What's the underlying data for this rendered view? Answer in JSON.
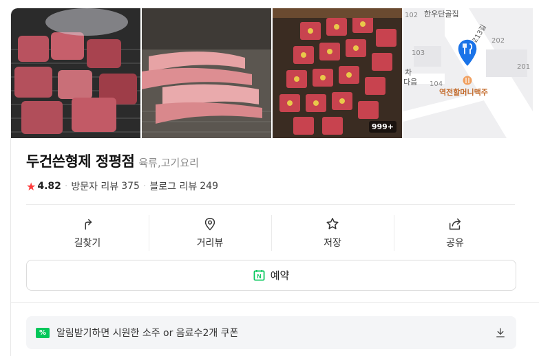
{
  "place": {
    "name": "두건쓴형제 정평점",
    "category": "육류,고기요리",
    "rating": "4.82",
    "visitor_review_label": "방문자 리뷰",
    "visitor_review_count": "375",
    "blog_review_label": "블로그 리뷰",
    "blog_review_count": "249"
  },
  "photos": {
    "count_badge": "999+"
  },
  "map": {
    "street_top": "한우단골집",
    "street_side": "로13길",
    "labels": [
      "102",
      "103",
      "104",
      "202",
      "201"
    ],
    "poi_name": "역전할머니맥주",
    "partial_text": "차",
    "partial_text2": "다음"
  },
  "actions": [
    {
      "label": "길찾기",
      "icon": "directions-icon"
    },
    {
      "label": "거리뷰",
      "icon": "street-view-icon"
    },
    {
      "label": "저장",
      "icon": "star-icon"
    },
    {
      "label": "공유",
      "icon": "share-icon"
    }
  ],
  "reservation": {
    "label": "예약",
    "icon_letter": "N"
  },
  "coupon": {
    "tag": "%",
    "text": "알림받기하면 시원한 소주 or 음료수2개 쿠폰"
  },
  "colors": {
    "star": "#ff3b3b",
    "naver_green": "#03c75a",
    "map_pin": "#1a73e8"
  }
}
